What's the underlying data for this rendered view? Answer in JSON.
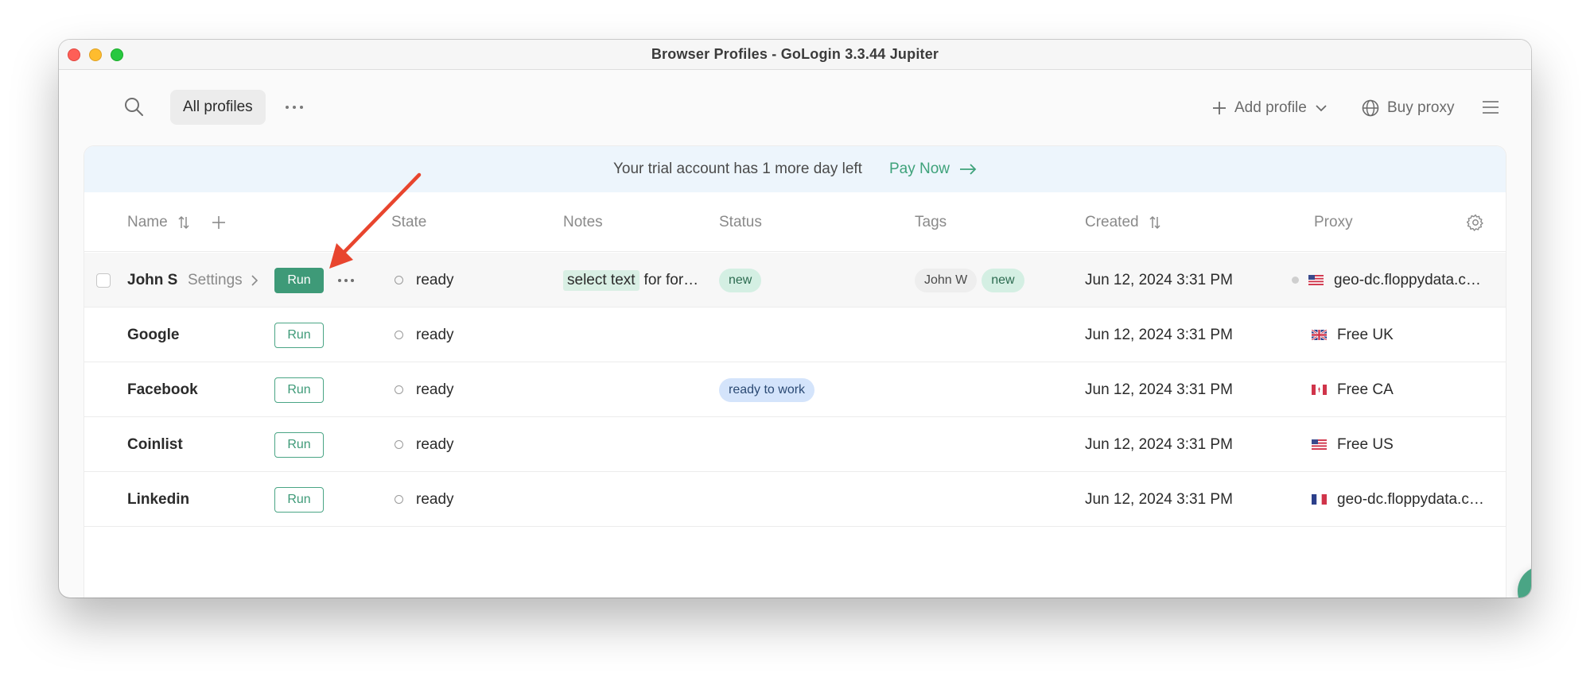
{
  "window": {
    "title": "Browser Profiles - GoLogin 3.3.44 Jupiter"
  },
  "toolbar": {
    "all_profiles_label": "All profiles",
    "add_profile_label": "Add profile",
    "buy_proxy_label": "Buy proxy"
  },
  "banner": {
    "text": "Your trial account has 1 more day left",
    "pay_now_label": "Pay Now"
  },
  "table": {
    "columns": {
      "name": "Name",
      "state": "State",
      "notes": "Notes",
      "status": "Status",
      "tags": "Tags",
      "created": "Created",
      "proxy": "Proxy"
    },
    "rows": [
      {
        "name": "John S",
        "settings_label": "Settings",
        "run_label": "Run",
        "state": "ready",
        "note_highlight": "select text",
        "note_rest": "for for…",
        "status": "new",
        "tags": [
          "John W",
          "new"
        ],
        "created": "Jun 12, 2024 3:31 PM",
        "proxy": "geo-dc.floppydata.c…",
        "flag": "us"
      },
      {
        "name": "Google",
        "run_label": "Run",
        "state": "ready",
        "created": "Jun 12, 2024 3:31 PM",
        "proxy": "Free UK",
        "flag": "uk"
      },
      {
        "name": "Facebook",
        "run_label": "Run",
        "state": "ready",
        "status": "ready to work",
        "created": "Jun 12, 2024 3:31 PM",
        "proxy": "Free CA",
        "flag": "ca"
      },
      {
        "name": "Coinlist",
        "run_label": "Run",
        "state": "ready",
        "created": "Jun 12, 2024 3:31 PM",
        "proxy": "Free US",
        "flag": "us"
      },
      {
        "name": "Linkedin",
        "run_label": "Run",
        "state": "ready",
        "created": "Jun 12, 2024 3:31 PM",
        "proxy": "geo-dc.floppydata.c…",
        "flag": "fr"
      }
    ]
  },
  "colors": {
    "accent_green": "#3e9a78",
    "annotation_arrow": "#e8452e",
    "banner_bg": "#edf5fc"
  },
  "icons": {
    "search": "search-icon",
    "more": "more-horizontal-icon",
    "plus": "plus-icon",
    "chevron_down": "chevron-down-icon",
    "globe": "globe-icon",
    "menu": "hamburger-menu-icon",
    "sort": "sort-icon",
    "gear": "gear-icon",
    "chat": "chat-icon",
    "arrow_right": "arrow-right-icon"
  }
}
